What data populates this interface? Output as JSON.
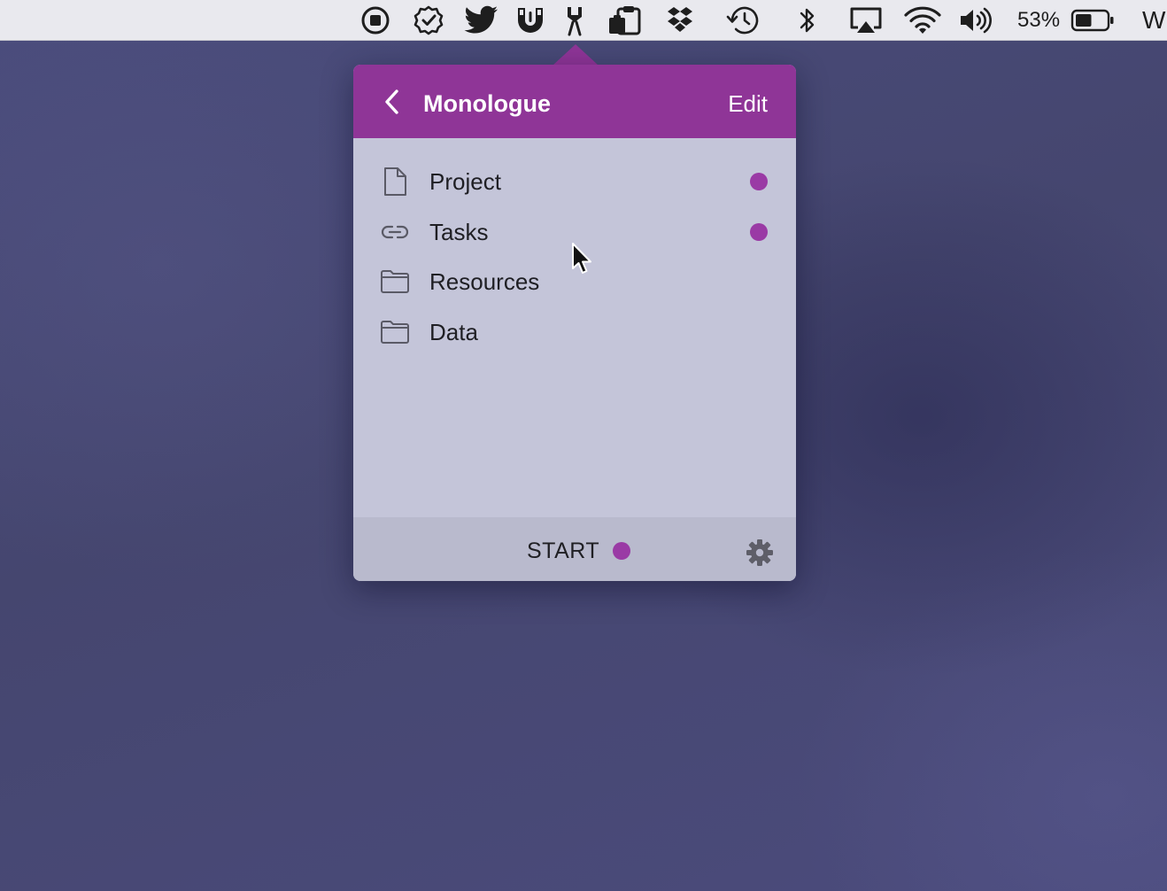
{
  "menubar": {
    "icons": [
      "stop-circle-icon",
      "checkmark-badge-icon",
      "twitter-bird-icon",
      "horseshoe-magnet-icon",
      "monologue-icon",
      "clipboard-stack-icon",
      "dropbox-icon",
      "time-machine-icon",
      "bluetooth-icon",
      "airplay-icon",
      "wifi-icon",
      "volume-icon"
    ],
    "battery_percent": "53%",
    "battery_level": 0.53,
    "clipped_text": "W"
  },
  "popover": {
    "title": "Monologue",
    "edit_label": "Edit",
    "accent_color": "#8f3597",
    "dot_color": "#9a3aa5",
    "items": [
      {
        "label": "Project",
        "icon": "document-icon",
        "has_dot": true
      },
      {
        "label": "Tasks",
        "icon": "link-icon",
        "has_dot": true
      },
      {
        "label": "Resources",
        "icon": "folder-icon",
        "has_dot": false
      },
      {
        "label": "Data",
        "icon": "folder-icon",
        "has_dot": false
      }
    ],
    "footer": {
      "start_label": "START"
    }
  }
}
